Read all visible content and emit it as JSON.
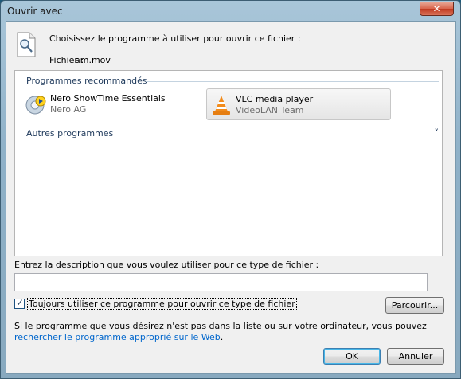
{
  "window": {
    "title": "Ouvrir avec",
    "close_glyph": "✕"
  },
  "header": {
    "prompt": "Choisissez le programme à utiliser pour ouvrir ce fichier :",
    "file_label": "Fichier :",
    "file_name": "am.mov"
  },
  "recommended": {
    "heading": "Programmes recommandés",
    "items": [
      {
        "name": "Nero ShowTime Essentials",
        "publisher": "Nero AG",
        "icon": "nero-showtime-icon"
      },
      {
        "name": "VLC media player",
        "publisher": "VideoLAN Team",
        "icon": "vlc-cone-icon"
      }
    ]
  },
  "other": {
    "heading": "Autres programmes",
    "expand_glyph": "˅"
  },
  "description": {
    "label": "Entrez la description que vous voulez utiliser pour ce type de fichier :",
    "value": ""
  },
  "always": {
    "label": "Toujours utiliser ce programme pour ouvrir ce type de fichier",
    "checked": true
  },
  "buttons": {
    "browse": "Parcourir...",
    "ok": "OK",
    "cancel": "Annuler"
  },
  "info": {
    "text": "Si le programme que vous désirez n'est pas dans la liste ou sur votre ordinateur, vous pouvez ",
    "link": "rechercher le programme approprié sur le Web",
    "end": "."
  },
  "colors": {
    "title_bar": "#a9c6d9",
    "close": "#c0391f",
    "link": "#0066cc",
    "group_heading": "#1e395b"
  }
}
